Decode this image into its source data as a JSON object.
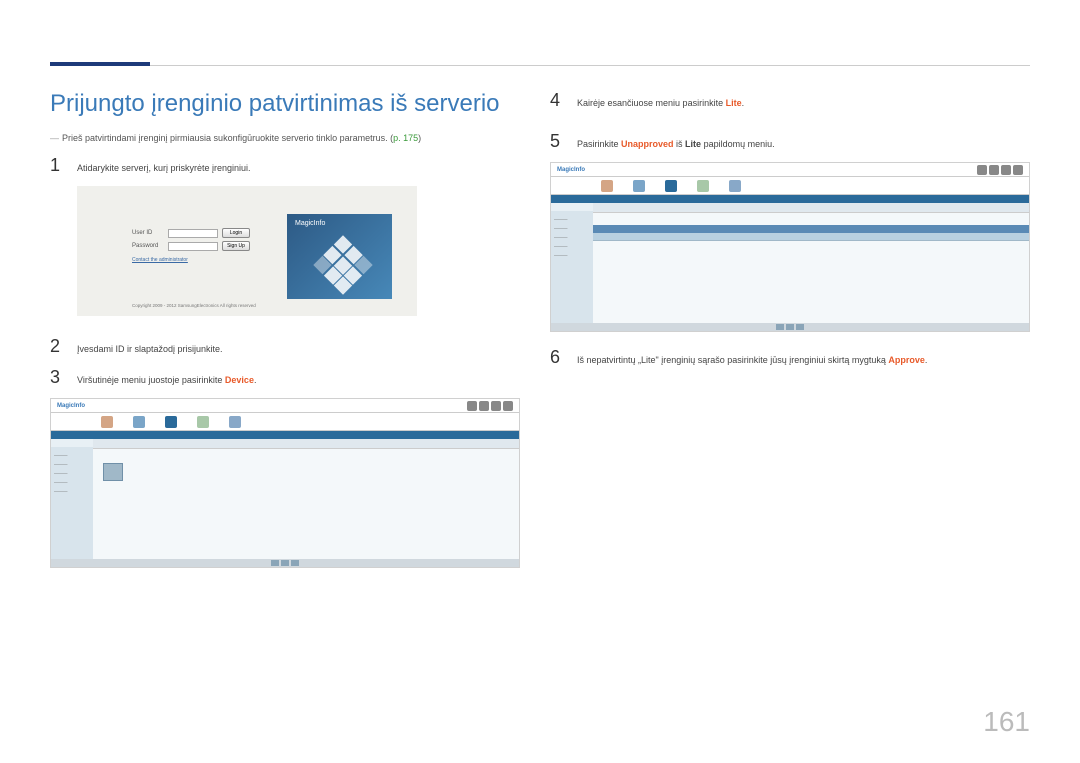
{
  "title": "Prijungto įrenginio patvirtinimas iš serverio",
  "note": {
    "text": "Prieš patvirtindami įrenginį pirmiausia sukonfigūruokite serverio tinklo parametrus. (",
    "link": "p. 175",
    "suffix": ")"
  },
  "steps": {
    "s1": {
      "num": "1",
      "text": "Atidarykite serverį, kurį priskyrėte įrenginiui."
    },
    "s2": {
      "num": "2",
      "text": "Įvesdami ID ir slaptažodį prisijunkite."
    },
    "s3": {
      "num": "3",
      "text_a": "Viršutinėje meniu juostoje pasirinkite ",
      "hl": "Device",
      "text_b": "."
    },
    "s4": {
      "num": "4",
      "text_a": "Kairėje esančiuose meniu pasirinkite ",
      "hl": "Lite",
      "text_b": "."
    },
    "s5": {
      "num": "5",
      "text_a": "Pasirinkite ",
      "hl": "Unapproved",
      "text_b": " iš ",
      "bold": "Lite",
      "text_c": " papildomų meniu."
    },
    "s6": {
      "num": "6",
      "text_a": "Iš nepatvirtintų „Lite\" įrenginių sąrašo pasirinkite jūsų įrenginiui skirtą mygtuką ",
      "hl": "Approve",
      "text_b": "."
    }
  },
  "login": {
    "user_id": "User ID",
    "password": "Password",
    "login_btn": "Login",
    "signup_btn": "Sign Up",
    "contact": "Contact the administrator",
    "copyright": "Copyright 2009 - 2012 SamsungElectronics All rights reserved",
    "logo": "MagicInfo"
  },
  "app": {
    "logo": "MagicInfo"
  },
  "page_number": "161"
}
